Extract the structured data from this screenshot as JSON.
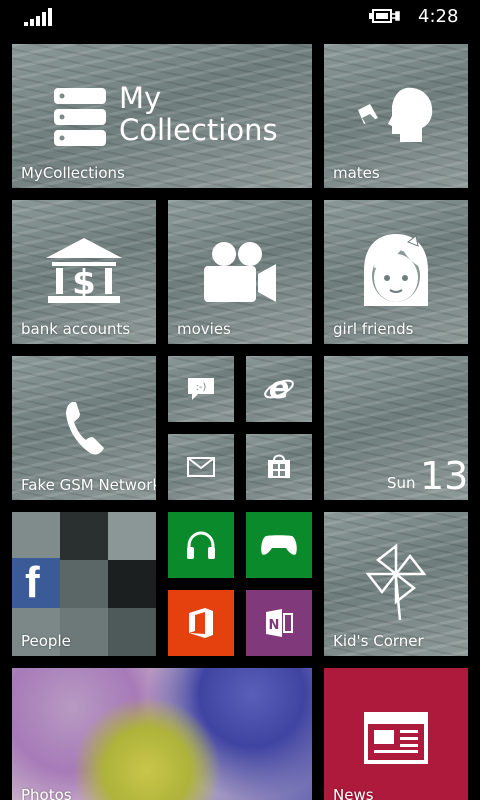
{
  "status_bar": {
    "signal_icon": "signal-strength-icon",
    "battery_icon": "battery-charging-icon",
    "time": "4:28"
  },
  "tiles": {
    "mycollections": {
      "label": "MyCollections",
      "logo_line1": "My",
      "logo_line2": "Collections",
      "icon": "database-stack-icon"
    },
    "mates": {
      "label": "mates",
      "icon": "head-with-bubble-icon"
    },
    "bank_accounts": {
      "label": "bank accounts",
      "icon": "bank-icon"
    },
    "movies": {
      "label": "movies",
      "icon": "movie-camera-icon"
    },
    "girl_friends": {
      "label": "girl friends",
      "icon": "girl-face-icon"
    },
    "fake_gsm": {
      "label": "Fake GSM Network",
      "icon": "phone-icon"
    },
    "messaging": {
      "icon": "messaging-icon"
    },
    "internet_explorer": {
      "icon": "internet-explorer-icon"
    },
    "mail": {
      "icon": "mail-icon"
    },
    "store": {
      "icon": "store-icon"
    },
    "calendar": {
      "day": "Sun",
      "date": "13"
    },
    "people": {
      "label": "People",
      "facebook_glyph": "f"
    },
    "music": {
      "icon": "headphones-icon",
      "color": "#0a8a2a"
    },
    "games": {
      "icon": "xbox-controller-icon",
      "color": "#0a8a2a"
    },
    "office": {
      "icon": "office-icon",
      "color": "#e5410e"
    },
    "onenote": {
      "icon": "onenote-icon",
      "color": "#80397b"
    },
    "kids_corner": {
      "label": "Kid's Corner",
      "icon": "pinwheel-icon"
    },
    "photos": {
      "label": "Photos"
    },
    "news": {
      "label": "News",
      "icon": "newspaper-icon",
      "color": "#ad1a3c"
    }
  }
}
